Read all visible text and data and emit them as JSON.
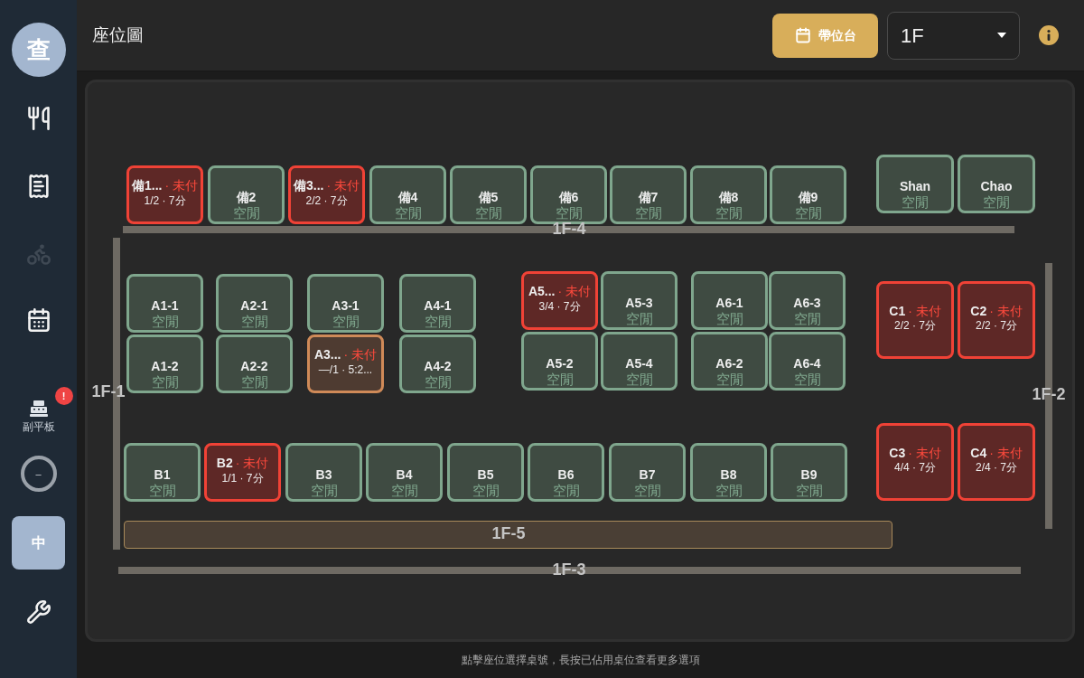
{
  "sidebar": {
    "items": [
      {
        "kind": "avatar",
        "text": "查"
      },
      {
        "kind": "icon",
        "disabled": false
      },
      {
        "kind": "icon",
        "disabled": false
      },
      {
        "kind": "icon",
        "disabled": true
      },
      {
        "kind": "icon",
        "disabled": false
      },
      {
        "kind": "register",
        "label": "副平板",
        "badge": "!"
      },
      {
        "kind": "ring",
        "text": "–"
      },
      {
        "kind": "toggle",
        "text": "中"
      },
      {
        "kind": "icon",
        "disabled": false
      }
    ]
  },
  "header": {
    "title": "座位圖",
    "action_button": "帶位台",
    "floor_select": {
      "value": "1F"
    }
  },
  "tables": [
    {
      "name": "備1...",
      "kind": "unpaid",
      "label": "· 未付",
      "detail": "1/2 · 7分"
    },
    {
      "name": "備2",
      "kind": "empty",
      "label": "空閒"
    },
    {
      "name": "備3...",
      "kind": "unpaid",
      "label": "· 未付",
      "detail": "2/2 · 7分"
    },
    {
      "name": "備4",
      "kind": "empty",
      "label": "空閒"
    },
    {
      "name": "備5",
      "kind": "empty",
      "label": "空閒"
    },
    {
      "name": "備6",
      "kind": "empty",
      "label": "空閒"
    },
    {
      "name": "備7",
      "kind": "empty",
      "label": "空閒"
    },
    {
      "name": "備8",
      "kind": "empty",
      "label": "空閒"
    },
    {
      "name": "備9",
      "kind": "empty",
      "label": "空閒"
    },
    {
      "name": "Shan",
      "kind": "empty",
      "label": "空閒"
    },
    {
      "name": "Chao",
      "kind": "empty",
      "label": "空閒"
    },
    {
      "name": "A1-1",
      "kind": "empty",
      "label": "空閒"
    },
    {
      "name": "A2-1",
      "kind": "empty",
      "label": "空閒"
    },
    {
      "name": "A3-1",
      "kind": "empty",
      "label": "空閒"
    },
    {
      "name": "A4-1",
      "kind": "empty",
      "label": "空閒"
    },
    {
      "name": "A5...",
      "kind": "unpaid",
      "label": "· 未付",
      "detail": "3/4 · 7分"
    },
    {
      "name": "A5-3",
      "kind": "empty",
      "label": "空閒"
    },
    {
      "name": "A6-1",
      "kind": "empty",
      "label": "空閒"
    },
    {
      "name": "A6-3",
      "kind": "empty",
      "label": "空閒"
    },
    {
      "name": "C1",
      "kind": "unpaid",
      "label": "· 未付",
      "detail": "2/2 · 7分"
    },
    {
      "name": "C2",
      "kind": "unpaid",
      "label": "· 未付",
      "detail": "2/2 · 7分"
    },
    {
      "name": "A1-2",
      "kind": "empty",
      "label": "空閒"
    },
    {
      "name": "A2-2",
      "kind": "empty",
      "label": "空閒"
    },
    {
      "name": "A3...",
      "kind": "pending",
      "label": "· 未付",
      "detail": "—/1 · 5:2..."
    },
    {
      "name": "A4-2",
      "kind": "empty",
      "label": "空閒"
    },
    {
      "name": "A5-2",
      "kind": "empty",
      "label": "空閒"
    },
    {
      "name": "A5-4",
      "kind": "empty",
      "label": "空閒"
    },
    {
      "name": "A6-2",
      "kind": "empty",
      "label": "空閒"
    },
    {
      "name": "A6-4",
      "kind": "empty",
      "label": "空閒"
    },
    {
      "name": "C3",
      "kind": "unpaid",
      "label": "· 未付",
      "detail": "4/4 · 7分"
    },
    {
      "name": "C4",
      "kind": "unpaid",
      "label": "· 未付",
      "detail": "2/4 · 7分"
    },
    {
      "name": "B1",
      "kind": "empty",
      "label": "空閒"
    },
    {
      "name": "B2",
      "kind": "unpaid",
      "label": "· 未付",
      "detail": "1/1 · 7分"
    },
    {
      "name": "B3",
      "kind": "empty",
      "label": "空閒"
    },
    {
      "name": "B4",
      "kind": "empty",
      "label": "空閒"
    },
    {
      "name": "B5",
      "kind": "empty",
      "label": "空閒"
    },
    {
      "name": "B6",
      "kind": "empty",
      "label": "空閒"
    },
    {
      "name": "B7",
      "kind": "empty",
      "label": "空閒"
    },
    {
      "name": "B8",
      "kind": "empty",
      "label": "空閒"
    },
    {
      "name": "B9",
      "kind": "empty",
      "label": "空閒"
    }
  ],
  "walls": [
    {
      "label": "1F-4",
      "kind": "wall"
    },
    {
      "label": "1F-1",
      "kind": "wall"
    },
    {
      "label": "1F-2",
      "kind": "wall"
    },
    {
      "label": "1F-5",
      "kind": "counter"
    },
    {
      "label": "1F-3",
      "kind": "wall"
    }
  ],
  "hint": "點擊座位選擇桌號，長按已佔用桌位查看更多選項"
}
